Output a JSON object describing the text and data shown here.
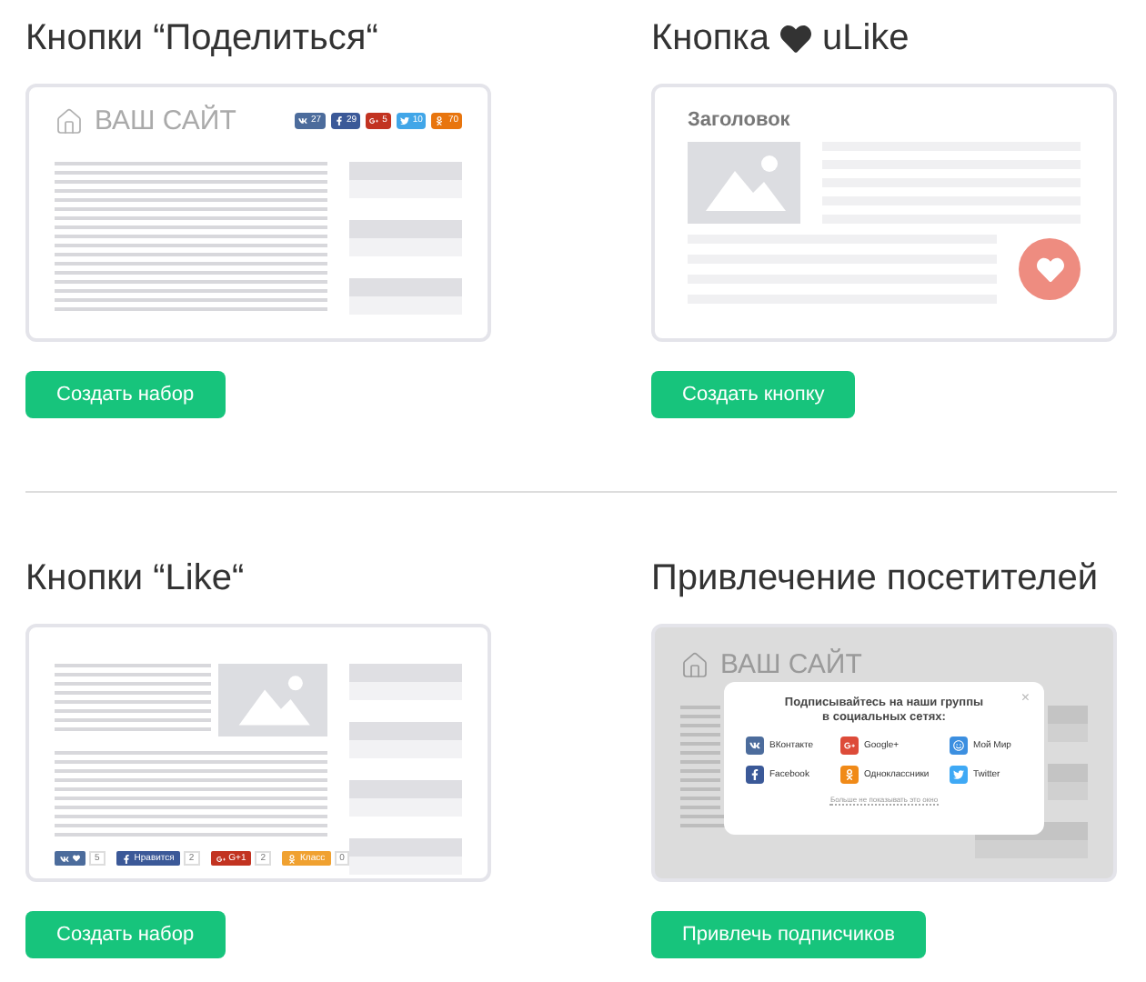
{
  "sections": [
    {
      "title": "Кнопки “Поделиться“",
      "kind": "share",
      "button": "Создать набор",
      "preview": {
        "site_title": "ВАШ САЙТ",
        "counters": [
          {
            "kind": "vk",
            "count": "27",
            "color": "#4c6c9c"
          },
          {
            "kind": "facebook",
            "count": "29",
            "color": "#3b5998"
          },
          {
            "kind": "googleplus",
            "count": "5",
            "color": "#c23321"
          },
          {
            "kind": "twitter",
            "count": "10",
            "color": "#41a6e8"
          },
          {
            "kind": "odnoklassniki",
            "count": "70",
            "color": "#e8750e"
          }
        ]
      }
    },
    {
      "title_before": "Кнопка",
      "title_after": "uLike",
      "kind": "ulike",
      "button": "Создать кнопку",
      "preview": {
        "heading": "Заголовок"
      }
    },
    {
      "title": "Кнопки “Like“",
      "kind": "like",
      "button": "Создать набор",
      "preview": {
        "likes": [
          {
            "kind": "vk",
            "count": "5",
            "color": "#4c6c9c"
          },
          {
            "kind": "facebook",
            "label": "Нравится",
            "count": "2",
            "color": "#3b5998"
          },
          {
            "kind": "googleplus",
            "label": "G+1",
            "count": "2",
            "color": "#c23321"
          },
          {
            "kind": "odnoklassniki",
            "label": "Класс",
            "count": "0",
            "color": "#f0a130"
          }
        ]
      }
    },
    {
      "title": "Привлечение посетителей",
      "kind": "popup",
      "button": "Привлечь подписчиков",
      "preview": {
        "site_title": "ВАШ САЙТ",
        "popup": {
          "title": "Подписывайтесь на наши группы в социальных сетях:",
          "close": "×",
          "networks": [
            {
              "kind": "vk",
              "label": "ВКонтакте",
              "color": "#4c6c9c"
            },
            {
              "kind": "googleplus",
              "label": "Google+",
              "color": "#dd4b39"
            },
            {
              "kind": "moimir",
              "label": "Мой Мир",
              "color": "#3c8fe0"
            },
            {
              "kind": "facebook",
              "label": "Facebook",
              "color": "#3b5998"
            },
            {
              "kind": "odnoklassniki",
              "label": "Одноклассники",
              "color": "#f08a18"
            },
            {
              "kind": "twitter",
              "label": "Twitter",
              "color": "#3fa9f5"
            }
          ],
          "footer": "Больше не показывать это окно"
        }
      }
    }
  ]
}
